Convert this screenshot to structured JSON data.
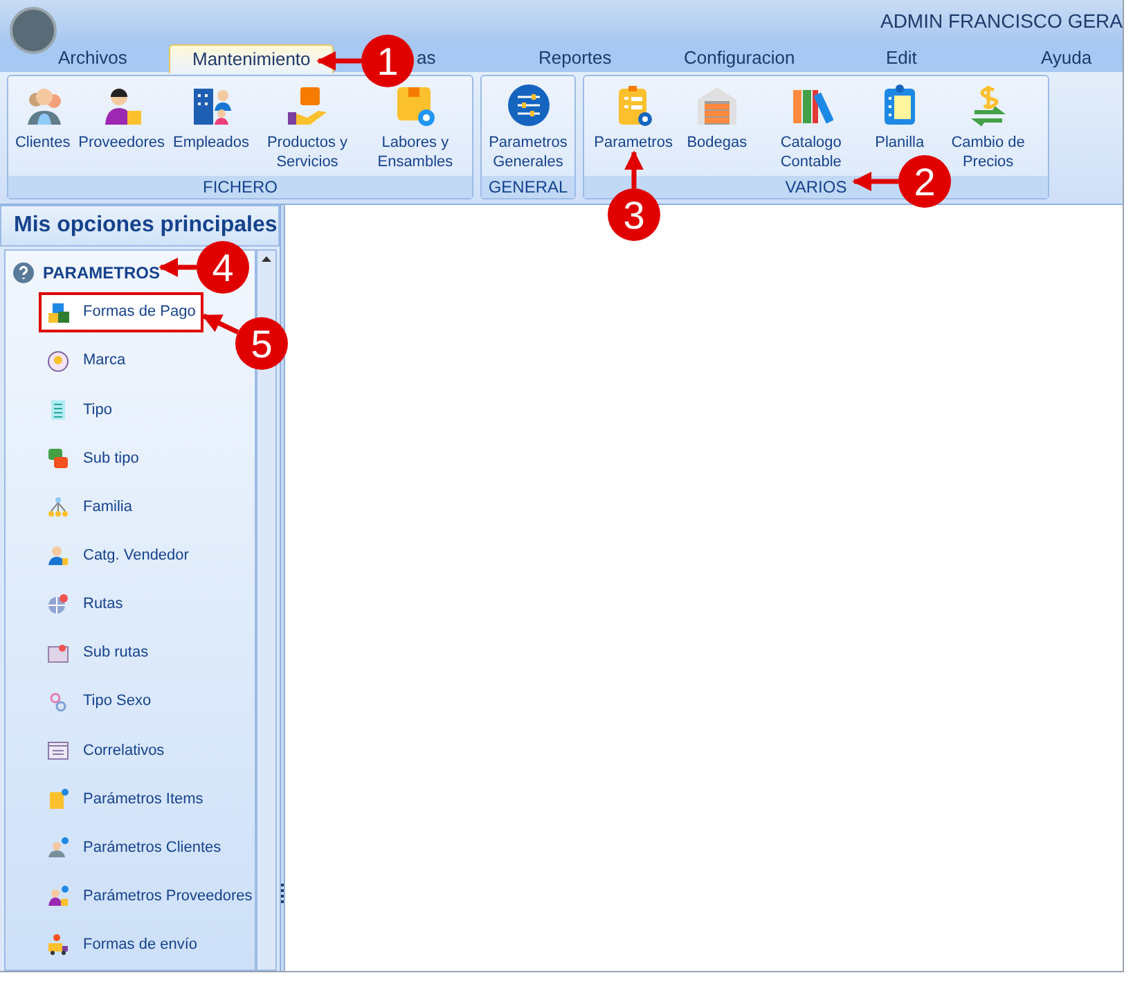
{
  "title_bar": {
    "user": "ADMIN FRANCISCO GERA"
  },
  "menu": [
    {
      "label": "Archivos",
      "selected": false
    },
    {
      "label": "Mantenimiento",
      "selected": true
    },
    {
      "label": "as",
      "selected": false
    },
    {
      "label": "Reportes",
      "selected": false
    },
    {
      "label": "Configuracion",
      "selected": false
    },
    {
      "label": "Edit",
      "selected": false
    },
    {
      "label": "Ayuda",
      "selected": false
    }
  ],
  "ribbon": [
    {
      "label": "FICHERO",
      "buttons": [
        "Clientes",
        "Proveedores",
        "Empleados",
        "Productos y Servicios",
        "Labores y Ensambles"
      ]
    },
    {
      "label": "GENERAL",
      "buttons": [
        "Parametros Generales"
      ]
    },
    {
      "label": "VARIOS",
      "buttons": [
        "Parametros",
        "Bodegas",
        "Catalogo Contable",
        "Planilla",
        "Cambio de Precios"
      ]
    }
  ],
  "sidebar": {
    "title": "Mis opciones principales",
    "section": "PARAMETROS",
    "items": [
      {
        "label": "Formas de Pago",
        "boxed": true
      },
      {
        "label": "Marca",
        "boxed": false
      },
      {
        "label": "Tipo",
        "boxed": false
      },
      {
        "label": "Sub tipo",
        "boxed": false
      },
      {
        "label": "Familia",
        "boxed": false
      },
      {
        "label": "Catg. Vendedor",
        "boxed": false
      },
      {
        "label": "Rutas",
        "boxed": false
      },
      {
        "label": "Sub rutas",
        "boxed": false
      },
      {
        "label": "Tipo Sexo",
        "boxed": false
      },
      {
        "label": "Correlativos",
        "boxed": false
      },
      {
        "label": "Parámetros Items",
        "boxed": false
      },
      {
        "label": "Parámetros Clientes",
        "boxed": false
      },
      {
        "label": "Parámetros Proveedores",
        "boxed": false
      },
      {
        "label": "Formas de envío",
        "boxed": false
      }
    ]
  },
  "callouts": [
    "1",
    "2",
    "3",
    "4",
    "5"
  ]
}
